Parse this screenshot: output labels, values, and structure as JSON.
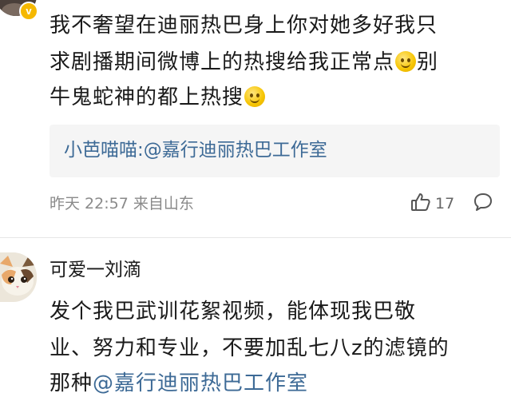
{
  "comment1": {
    "lines": [
      "我不奢望在迪丽热巴身上你对她多好我只",
      "求剧播期间微博上的热搜给我正常点",
      "别",
      "牛鬼蛇神的都上热搜"
    ],
    "reply_user": "小芭喵喵:",
    "reply_mention": "@嘉行迪丽热巴工作室",
    "time": "昨天 22:57 来自山东",
    "like_count": "17",
    "verified_badge": "v"
  },
  "comment2": {
    "username": "可爱一刘滴",
    "lines": [
      "发个我巴武训花絮视频，能体现我巴敬",
      "业、努力和专业，不要加乱七八z的滤镜的"
    ],
    "line3_prefix": "那种",
    "mention": "@嘉行迪丽热巴工作室"
  },
  "icons": {
    "like": "thumbs-up-icon",
    "comment": "comment-bubble-icon",
    "emoji": "smile-emoji-icon"
  },
  "colors": {
    "link": "#3d6a96",
    "badge": "#f5b800",
    "meta": "#8a8a8a"
  }
}
